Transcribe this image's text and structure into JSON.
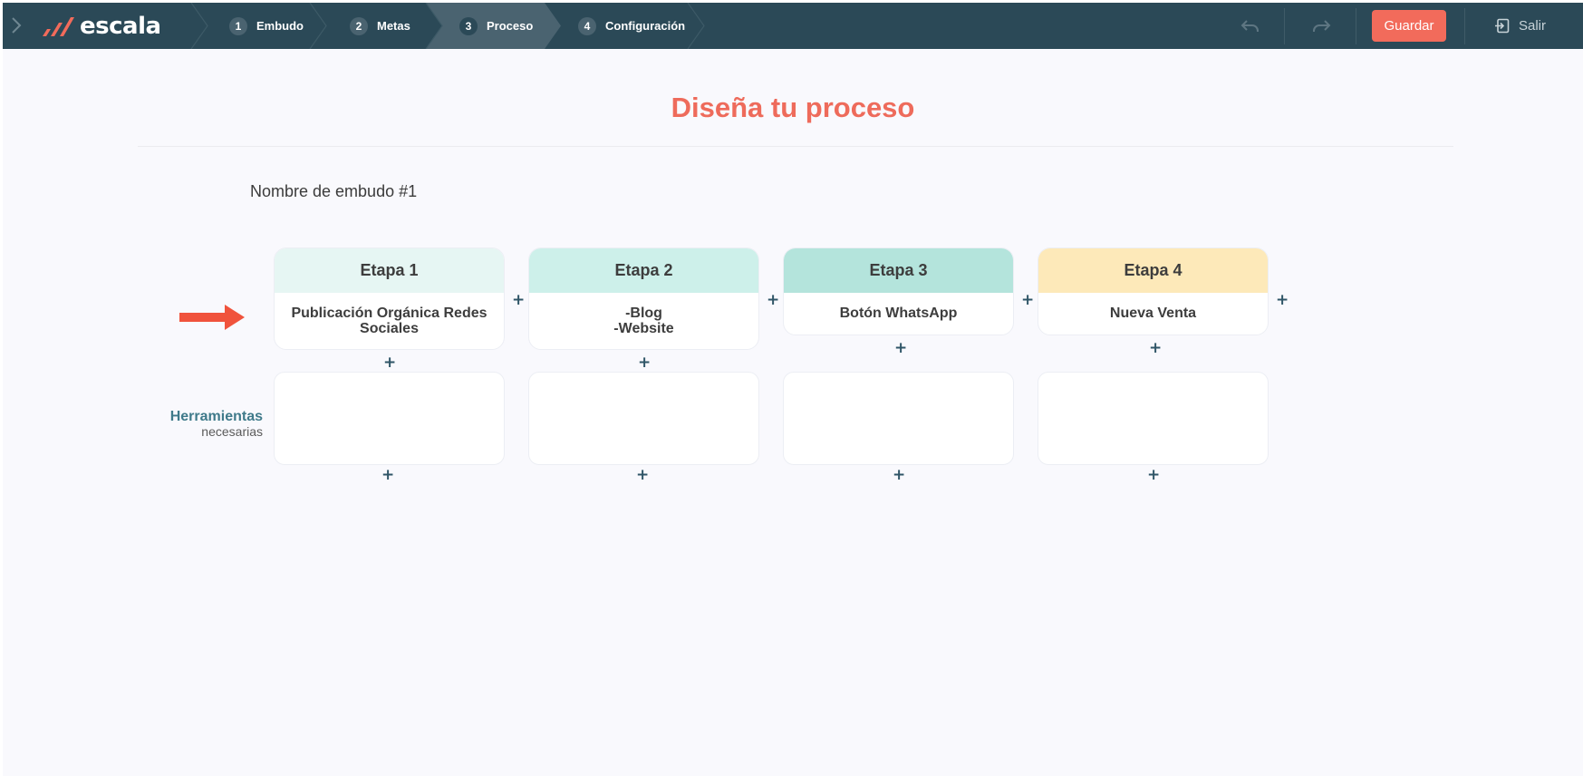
{
  "brand": {
    "name": "escala"
  },
  "steps": [
    {
      "num": "1",
      "label": "Embudo"
    },
    {
      "num": "2",
      "label": "Metas"
    },
    {
      "num": "3",
      "label": "Proceso"
    },
    {
      "num": "4",
      "label": "Configuración"
    }
  ],
  "toolbar": {
    "save_label": "Guardar",
    "exit_label": "Salir"
  },
  "main": {
    "title": "Diseña tu proceso",
    "funnel_name": "Nombre de embudo #1",
    "tools_label": "Herramientas",
    "tools_sublabel": "necesarias"
  },
  "stages": [
    {
      "title": "Etapa 1",
      "lines": [
        "Publicación Orgánica Redes",
        "Sociales"
      ],
      "header_color": "#e6f6f3"
    },
    {
      "title": "Etapa 2",
      "lines": [
        "-Blog",
        "-Website"
      ],
      "header_color": "#cdf0ea"
    },
    {
      "title": "Etapa 3",
      "lines": [
        "Botón WhatsApp"
      ],
      "header_color": "#b4e4dc"
    },
    {
      "title": "Etapa 4",
      "lines": [
        "Nueva Venta"
      ],
      "header_color": "#fde9b9"
    }
  ],
  "plus_symbol": "+",
  "colors": {
    "topbar": "#2b4957",
    "accent": "#f26b5b",
    "title": "#ee6b5b"
  }
}
